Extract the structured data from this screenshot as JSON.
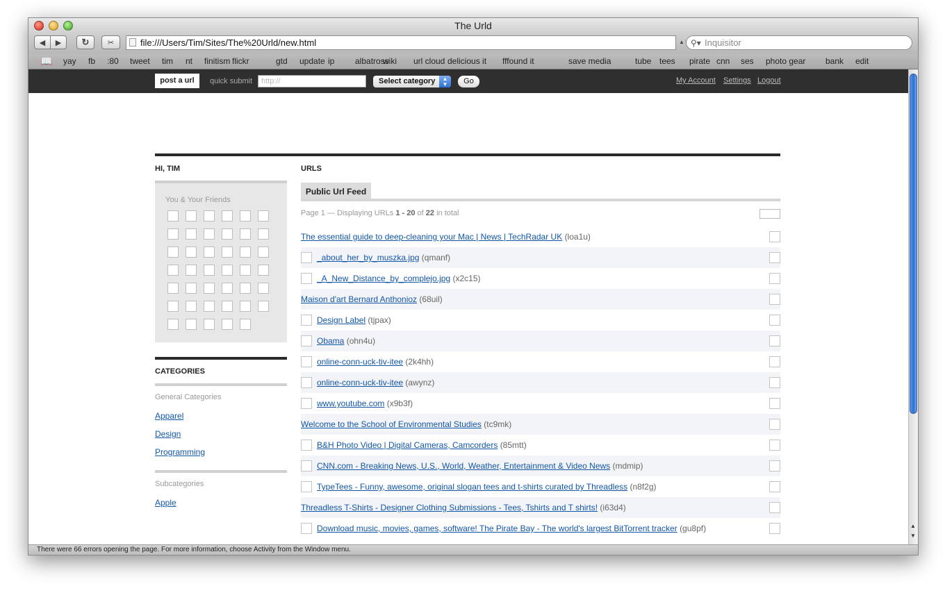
{
  "window": {
    "title": "The Urld",
    "address": "file:///Users/Tim/Sites/The%20Urld/new.html",
    "search_placeholder": "Inquisitor",
    "status": "There were 66 errors opening the page. For more information, choose Activity from the Window menu."
  },
  "bookmarks": [
    "yay",
    "fb",
    ":80",
    "tweet",
    "tim",
    "nt",
    "finitism",
    "flickr",
    "gtd",
    "update",
    "ip",
    "albatross",
    "wiki",
    "url cloud",
    "delicious it",
    "fffound it",
    "save media",
    "tube",
    "tees",
    "pirate",
    "cnn",
    "ses",
    "photo gear",
    "bank",
    "edit"
  ],
  "topbar": {
    "post_url": "post a url",
    "quick_submit": "quick submit",
    "quick_placeholder": "http://",
    "select_category": "Select category",
    "go": "Go",
    "my_account": "My Account",
    "settings": "Settings",
    "logout": "Logout"
  },
  "sidebar": {
    "greeting": "HI, TIM",
    "friends_label": "You & Your Friends",
    "categories_heading": "CATEGORIES",
    "general_label": "General Categories",
    "general": [
      "Apparel",
      "Design",
      "Programming"
    ],
    "sub_label": "Subcategories",
    "sub": [
      "Apple"
    ]
  },
  "main": {
    "heading": "URLS",
    "tab": "Public Url Feed",
    "page_prefix": "Page 1 — Displaying URLs ",
    "page_range": "1 - 20",
    "page_of": " of ",
    "page_total": "22",
    "page_suffix": " in total",
    "rows": [
      {
        "title": "The essential guide to deep-cleaning your Mac | News | TechRadar UK",
        "code": "(loa1u)",
        "indent": false
      },
      {
        "title": "_about_her_by_muszka.jpg",
        "code": "(qmanf)",
        "indent": true
      },
      {
        "title": "_A_New_Distance_by_complejo.jpg",
        "code": "(x2c15)",
        "indent": true
      },
      {
        "title": "Maison d'art Bernard Anthonioz",
        "code": "(68uil)",
        "indent": false
      },
      {
        "title": "Design Label",
        "code": "(tjpax)",
        "indent": true
      },
      {
        "title": "Obama",
        "code": "(ohn4u)",
        "indent": true
      },
      {
        "title": "online-conn-uck-tiv-itee",
        "code": "(2k4hh)",
        "indent": true
      },
      {
        "title": "online-conn-uck-tiv-itee",
        "code": "(awynz)",
        "indent": true
      },
      {
        "title": "www.youtube.com",
        "code": "(x9b3f)",
        "indent": true
      },
      {
        "title": "Welcome to the School of Environmental Studies",
        "code": "(tc9mk)",
        "indent": false
      },
      {
        "title": "B&H Photo Video | Digital Cameras, Camcorders",
        "code": "(85mtt)",
        "indent": true
      },
      {
        "title": "CNN.com - Breaking News, U.S., World, Weather, Entertainment & Video News",
        "code": "(mdmip)",
        "indent": true
      },
      {
        "title": "TypeTees - Funny, awesome, original slogan tees and t-shirts curated by Threadless",
        "code": "(n8f2g)",
        "indent": true
      },
      {
        "title": "Threadless T-Shirts - Designer Clothing Submissions - Tees, Tshirts and T shirts!",
        "code": "(i63d4)",
        "indent": false
      },
      {
        "title": "Download music, movies, games, software! The Pirate Bay - The world's largest BitTorrent tracker",
        "code": "(gu8pf)",
        "indent": true
      }
    ]
  }
}
